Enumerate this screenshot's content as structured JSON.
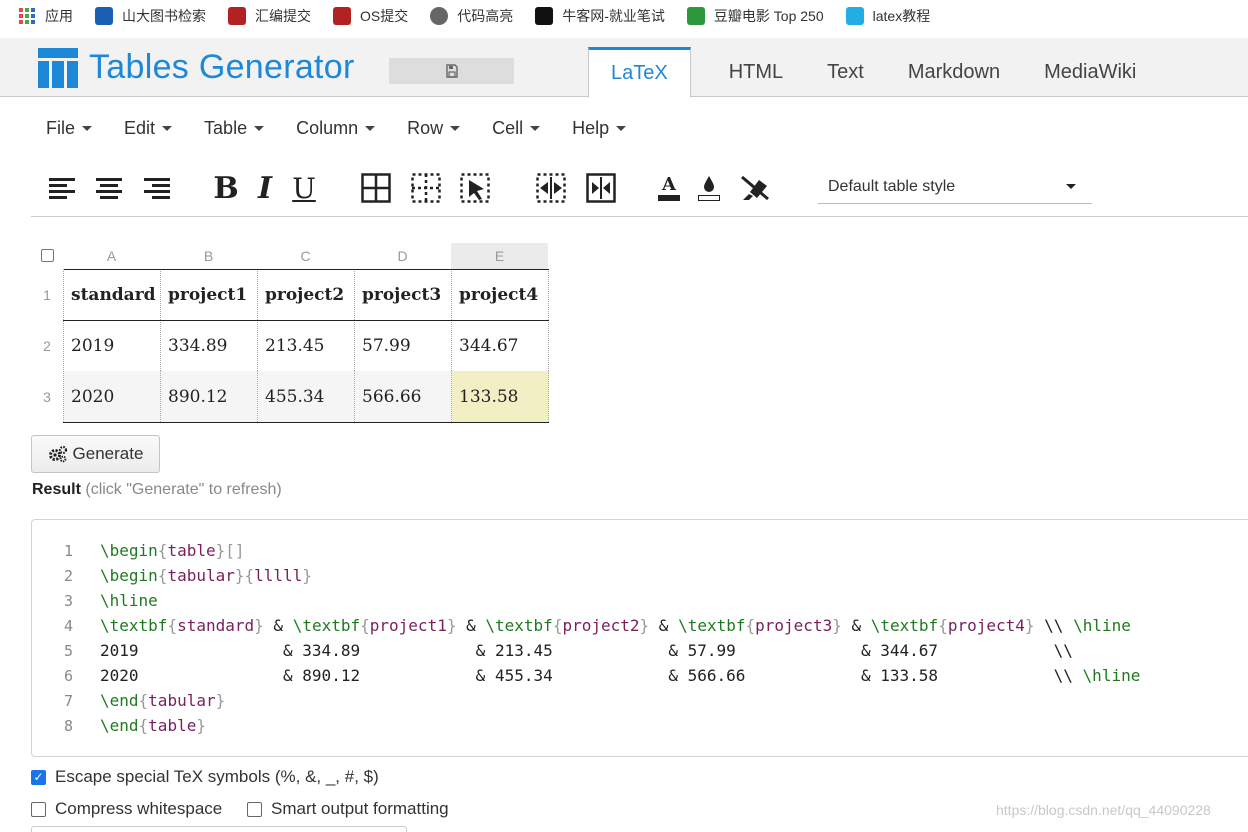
{
  "bookmarks": [
    {
      "label": "应用",
      "icon": "apps-grid-icon"
    },
    {
      "label": "山大图书检索",
      "icon": "library-icon",
      "color": "#1a5fb4"
    },
    {
      "label": "汇编提交",
      "icon": "school-emblem-icon",
      "color": "#b22222"
    },
    {
      "label": "OS提交",
      "icon": "school-emblem-icon",
      "color": "#b22222"
    },
    {
      "label": "代码高亮",
      "icon": "globe-icon",
      "color": "#666666"
    },
    {
      "label": "牛客网-就业笔试",
      "icon": "nowcoder-icon",
      "color": "#111111"
    },
    {
      "label": "豆瓣电影 Top 250",
      "icon": "douban-icon",
      "color": "#2e963d"
    },
    {
      "label": "latex教程",
      "icon": "bilibili-icon",
      "color": "#23ade5"
    }
  ],
  "header": {
    "logo_text": "Tables Generator",
    "tabs": [
      "LaTeX",
      "HTML",
      "Text",
      "Markdown",
      "MediaWiki"
    ],
    "active_tab": "LaTeX",
    "accent": "#1e88d8"
  },
  "menu": [
    "File",
    "Edit",
    "Table",
    "Column",
    "Row",
    "Cell",
    "Help"
  ],
  "toolbar": {
    "icons": [
      "align-left-icon",
      "align-center-icon",
      "align-right-icon",
      "bold-icon",
      "italic-icon",
      "underline-icon",
      "all-borders-icon",
      "inner-borders-icon",
      "clear-borders-icon",
      "merge-cells-icon",
      "split-cells-icon",
      "text-color-icon",
      "background-color-icon",
      "clear-formatting-icon"
    ],
    "bold_glyph": "B",
    "italic_glyph": "I",
    "underline_glyph": "U",
    "text_color_glyph": "A",
    "style_select": "Default table style"
  },
  "grid": {
    "columns": [
      "A",
      "B",
      "C",
      "D",
      "E"
    ],
    "row_numbers": [
      "1",
      "2",
      "3"
    ],
    "rows": [
      [
        "standard",
        "project1",
        "project2",
        "project3",
        "project4"
      ],
      [
        "2019",
        "334.89",
        "213.45",
        "57.99",
        "344.67"
      ],
      [
        "2020",
        "890.12",
        "455.34",
        "566.66",
        "133.58"
      ]
    ],
    "selected_cell_bg": "#f3efc4"
  },
  "generate_label": "Generate",
  "result": {
    "label": "Result",
    "hint": "(click \"Generate\" to refresh)"
  },
  "code_lines": [
    {
      "n": "1",
      "parts": [
        [
          "kw",
          "\\begin"
        ],
        [
          "br",
          "{"
        ],
        [
          "arg",
          "table"
        ],
        [
          "br",
          "}[]"
        ]
      ]
    },
    {
      "n": "2",
      "parts": [
        [
          "kw",
          "\\begin"
        ],
        [
          "br",
          "{"
        ],
        [
          "arg",
          "tabular"
        ],
        [
          "br",
          "}{"
        ],
        [
          "arg",
          "lllll"
        ],
        [
          "br",
          "}"
        ]
      ]
    },
    {
      "n": "3",
      "parts": [
        [
          "kw",
          "\\hline"
        ]
      ]
    },
    {
      "n": "4",
      "parts": [
        [
          "kw",
          "\\textbf"
        ],
        [
          "br",
          "{"
        ],
        [
          "arg",
          "standard"
        ],
        [
          "br",
          "}"
        ],
        [
          "tx",
          " & "
        ],
        [
          "kw",
          "\\textbf"
        ],
        [
          "br",
          "{"
        ],
        [
          "arg",
          "project1"
        ],
        [
          "br",
          "}"
        ],
        [
          "tx",
          " & "
        ],
        [
          "kw",
          "\\textbf"
        ],
        [
          "br",
          "{"
        ],
        [
          "arg",
          "project2"
        ],
        [
          "br",
          "}"
        ],
        [
          "tx",
          " & "
        ],
        [
          "kw",
          "\\textbf"
        ],
        [
          "br",
          "{"
        ],
        [
          "arg",
          "project3"
        ],
        [
          "br",
          "}"
        ],
        [
          "tx",
          " & "
        ],
        [
          "kw",
          "\\textbf"
        ],
        [
          "br",
          "{"
        ],
        [
          "arg",
          "project4"
        ],
        [
          "br",
          "}"
        ],
        [
          "tx",
          " \\\\ "
        ],
        [
          "kw",
          "\\hline"
        ]
      ]
    },
    {
      "n": "5",
      "parts": [
        [
          "tx",
          "2019               & 334.89            & 213.45            & 57.99             & 344.67            \\\\"
        ]
      ]
    },
    {
      "n": "6",
      "parts": [
        [
          "tx",
          "2020               & 890.12            & 455.34            & 566.66            & 133.58            \\\\ "
        ],
        [
          "kw",
          "\\hline"
        ]
      ]
    },
    {
      "n": "7",
      "parts": [
        [
          "kw",
          "\\end"
        ],
        [
          "br",
          "{"
        ],
        [
          "arg",
          "tabular"
        ],
        [
          "br",
          "}"
        ]
      ]
    },
    {
      "n": "8",
      "parts": [
        [
          "kw",
          "\\end"
        ],
        [
          "br",
          "{"
        ],
        [
          "arg",
          "table"
        ],
        [
          "br",
          "}"
        ]
      ]
    }
  ],
  "options": [
    {
      "label": "Escape special TeX symbols (%, &, _, #, $)",
      "checked": true
    },
    {
      "label": "Compress whitespace",
      "checked": false
    },
    {
      "label": "Smart output formatting",
      "checked": false
    }
  ],
  "watermark": "https://blog.csdn.net/qq_44090228"
}
